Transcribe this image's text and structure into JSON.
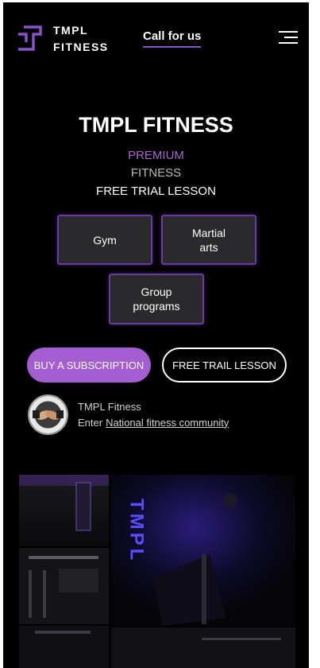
{
  "header": {
    "logo_line1": "TMPL",
    "logo_line2": "FITNESS",
    "call_label": "Call for us"
  },
  "hero": {
    "title": "TMPL FITNESS",
    "tag1": "PREMIUM",
    "tag2": "FITNESS",
    "tag3": "FREE TRIAL LESSON"
  },
  "categories": {
    "gym": "Gym",
    "martial_1": "Martial",
    "martial_2": "arts",
    "group_1": "Group",
    "group_2": "programs"
  },
  "actions": {
    "buy": "BUY A SUBSCRIPTION",
    "free": "FREE TRAIL LESSON"
  },
  "community": {
    "name": "TMPL Fitness",
    "enter": "Enter",
    "link": "National fitness community"
  },
  "gallery": {
    "neon_text": "TMPL"
  },
  "colors": {
    "accent": "#a55ed1",
    "border_purple": "#6a3aa4",
    "background": "#000000"
  }
}
